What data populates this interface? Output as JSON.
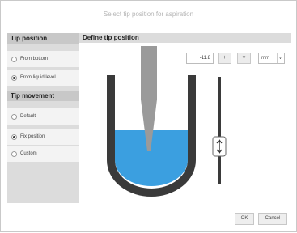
{
  "dialog": {
    "title": "Select tip position for aspiration"
  },
  "tip_position": {
    "header": "Tip position",
    "options": [
      {
        "label": "From bottom",
        "selected": false
      },
      {
        "label": "From liquid level",
        "selected": true
      }
    ]
  },
  "tip_movement": {
    "header": "Tip movement",
    "options": [
      {
        "label": "Default",
        "selected": false
      },
      {
        "label": "Fix position",
        "selected": true
      },
      {
        "label": "Custom",
        "selected": false
      }
    ]
  },
  "define": {
    "header": "Define tip position",
    "value": "-11.8",
    "increment_label": "+",
    "decrement_label": "▾",
    "unit": "mm",
    "unit_arrow": "∨"
  },
  "buttons": {
    "ok": "OK",
    "cancel": "Cancel"
  },
  "colors": {
    "liquid": "#3b9fe0",
    "tube": "#3a3a3a",
    "tip": "#9a9a9a"
  },
  "icons": {
    "position-slider-handle": "up-down-arrow-icon"
  }
}
